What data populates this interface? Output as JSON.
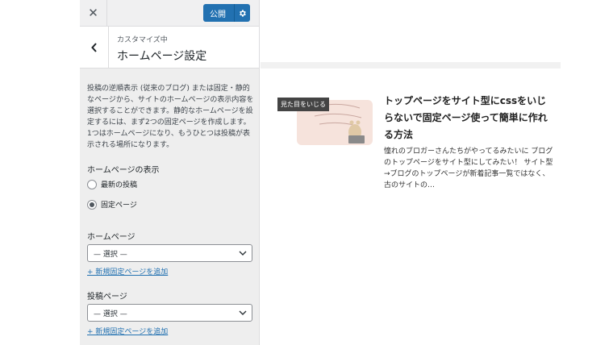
{
  "topbar": {
    "close_label": "✕",
    "publish_label": "公開"
  },
  "section": {
    "meta": "カスタマイズ中",
    "title": "ホームページ設定"
  },
  "description": "投稿の逆順表示 (従来のブログ) または固定・静的なページから、サイトのホームページの表示内容を選択することができます。静的なホームページを設定するには、まず2つの固定ページを作成します。1つはホームページになり、もうひとつは投稿が表示される場所になります。",
  "homepage_display": {
    "label": "ホームページの表示",
    "options": [
      {
        "label": "最新の投稿",
        "selected": false
      },
      {
        "label": "固定ページ",
        "selected": true
      }
    ]
  },
  "homepage_select": {
    "label": "ホームページ",
    "value": "— 選択 —",
    "add_link": "+ 新規固定ページを追加"
  },
  "posts_select": {
    "label": "投稿ページ",
    "value": "— 選択 —",
    "add_link": "+ 新規固定ページを追加"
  },
  "preview": {
    "thumbnail_badge": "見た目をいじる",
    "post_title": "トップページをサイト型にcssをいじらないで固定ページ使って簡単に作れる方法",
    "post_excerpt": "憧れのブロガーさんたちがやってるみたいに ブログのトップページをサイト型にしてみたい！ サイト型→ブログのトップページが新着記事一覧ではなく、古のサイトの…"
  },
  "colors": {
    "accent": "#2271b1",
    "sidebar_bg": "#eeeeee",
    "link": "#2271b1"
  },
  "icons": {
    "close": "close-icon",
    "back": "chevron-left-icon",
    "gear": "gear-icon",
    "select_arrow": "chevron-down-icon"
  }
}
